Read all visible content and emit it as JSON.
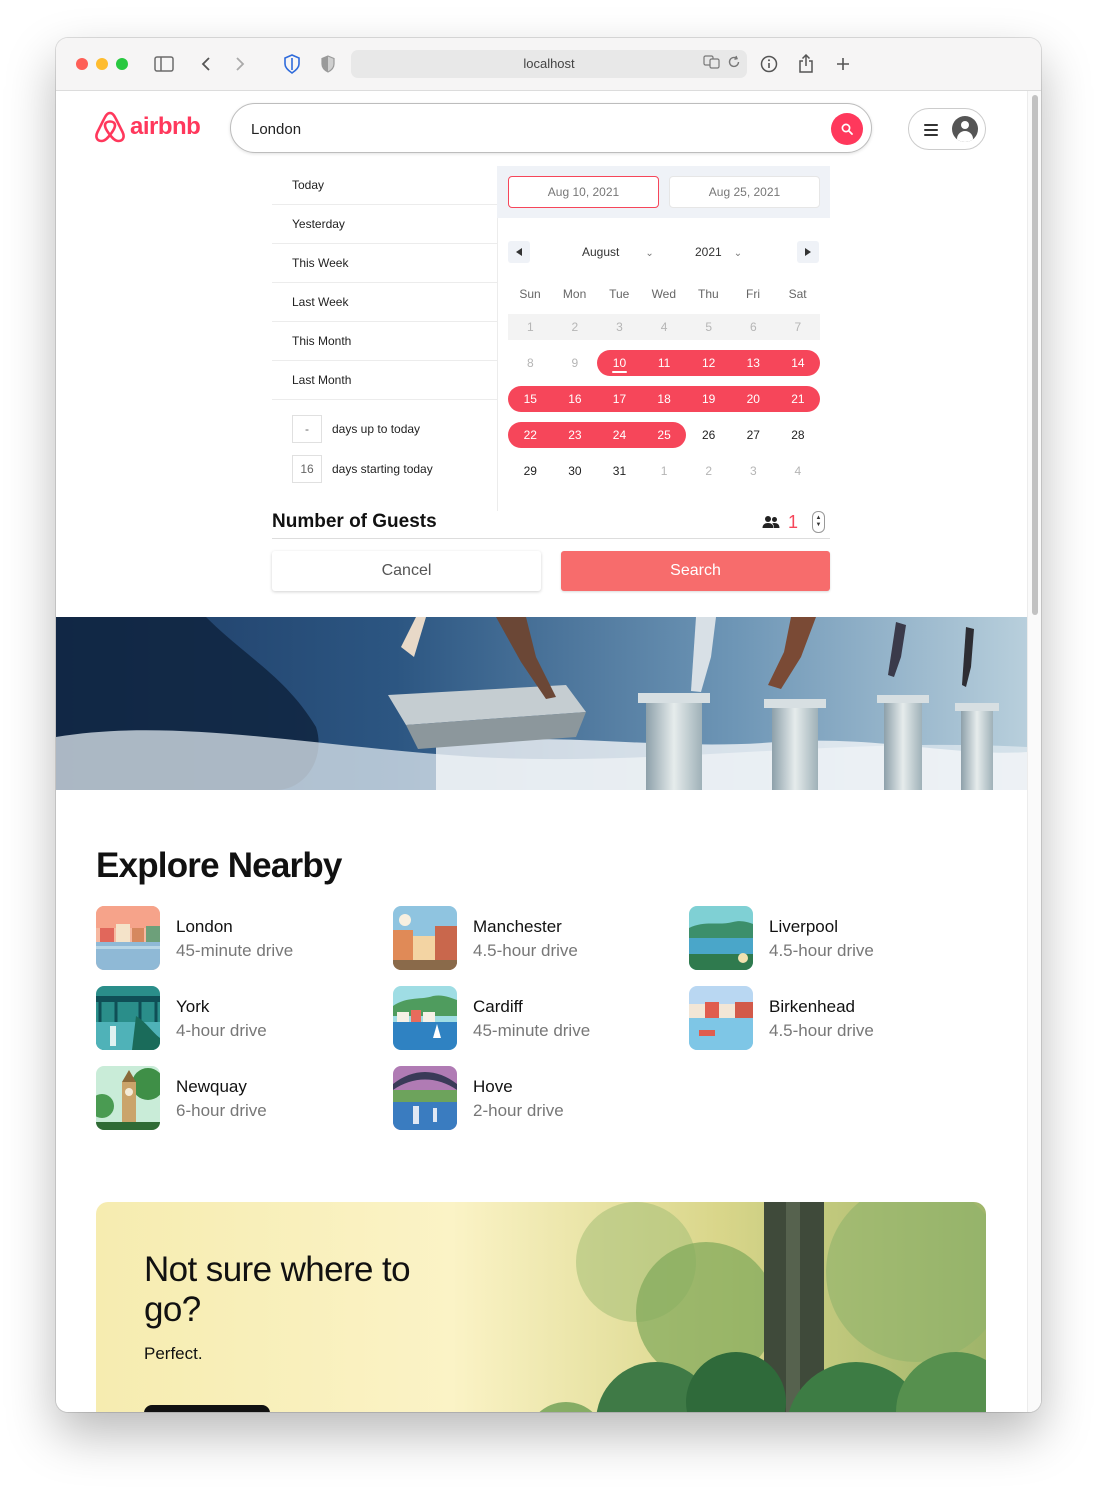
{
  "browser": {
    "url": "localhost"
  },
  "header": {
    "logo_text": "airbnb",
    "search_value": "London",
    "brand_color": "#ff385c"
  },
  "date_picker": {
    "ranges": [
      "Today",
      "Yesterday",
      "This Week",
      "Last Week",
      "This Month",
      "Last Month"
    ],
    "days_up_to_today": {
      "value": "-",
      "label": "days up to today"
    },
    "days_starting_today": {
      "value": "16",
      "label": "days starting today"
    },
    "start_date": "Aug 10, 2021",
    "end_date": "Aug 25, 2021",
    "month": "August",
    "year": "2021",
    "weekdays": [
      "Sun",
      "Mon",
      "Tue",
      "Wed",
      "Thu",
      "Fri",
      "Sat"
    ],
    "weeks": [
      [
        "1",
        "2",
        "3",
        "4",
        "5",
        "6",
        "7"
      ],
      [
        "8",
        "9",
        "10",
        "11",
        "12",
        "13",
        "14"
      ],
      [
        "15",
        "16",
        "17",
        "18",
        "19",
        "20",
        "21"
      ],
      [
        "22",
        "23",
        "24",
        "25",
        "26",
        "27",
        "28"
      ],
      [
        "29",
        "30",
        "31",
        "1",
        "2",
        "3",
        "4"
      ]
    ],
    "selected_range": [
      10,
      25
    ],
    "today": 10,
    "selection_color": "#f6465a"
  },
  "guests": {
    "label": "Number of Guests",
    "count": "1",
    "cancel_label": "Cancel",
    "search_label": "Search"
  },
  "explore": {
    "title": "Explore Nearby",
    "items": [
      {
        "name": "London",
        "distance": "45-minute drive"
      },
      {
        "name": "Manchester",
        "distance": "4.5-hour drive"
      },
      {
        "name": "Liverpool",
        "distance": "4.5-hour drive"
      },
      {
        "name": "York",
        "distance": "4-hour drive"
      },
      {
        "name": "Cardiff",
        "distance": "45-minute drive"
      },
      {
        "name": "Birkenhead",
        "distance": "4.5-hour drive"
      },
      {
        "name": "Newquay",
        "distance": "6-hour drive"
      },
      {
        "name": "Hove",
        "distance": "2-hour drive"
      }
    ]
  },
  "promo": {
    "title": "Not sure where to go?",
    "subtitle": "Perfect."
  }
}
